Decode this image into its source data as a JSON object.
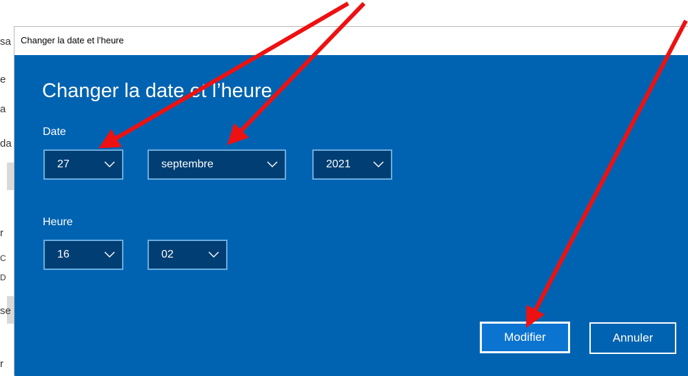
{
  "background_window": {
    "fragments": [
      "sa",
      "e",
      "a",
      "da",
      "r",
      "C",
      "D",
      "se",
      "r"
    ]
  },
  "dialog": {
    "window_title": "Changer la date et l’heure",
    "heading": "Changer la date et l’heure",
    "date_label": "Date",
    "day": "27",
    "month": "septembre",
    "year": "2021",
    "time_label": "Heure",
    "hour": "16",
    "minute": "02",
    "modify_label": "Modifier",
    "cancel_label": "Annuler"
  },
  "annotations": {
    "arrow_color": "#ee1111"
  },
  "colors": {
    "dialog_background": "#0063b1",
    "select_background": "#003e73",
    "select_border": "#6aaee0",
    "primary_button": "#0b74d1"
  }
}
